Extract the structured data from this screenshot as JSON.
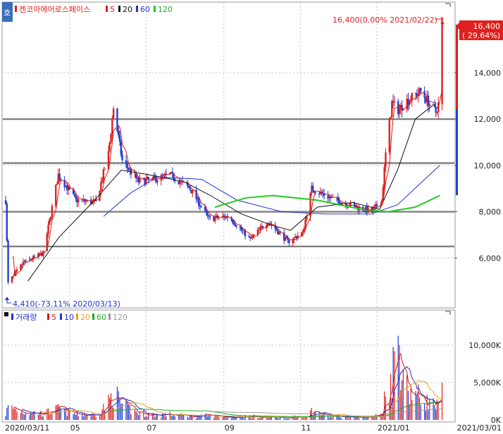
{
  "colors": {
    "up": "#e0201e",
    "down": "#1f3fd8",
    "ma5": "#d01a1a",
    "ma20": "#111111",
    "ma60": "#2233cc",
    "ma120": "#22cc22",
    "vol_ma5": "#d01a1a",
    "vol_ma10": "#2233cc",
    "vol_ma20": "#e8a020",
    "vol_ma60": "#22aa22",
    "vol_ma120": "#999999",
    "support_line": "#808080",
    "grid": "#c8c8c8",
    "price_tag_bg": "#e0201e"
  },
  "price_panel": {
    "badge": "호",
    "legend": {
      "name": "켄코아에어로스페이스",
      "ma5": "5",
      "ma20": "20",
      "ma60": "60",
      "ma120": "120"
    },
    "high_label": "16,400(0.00% 2021/02/22)",
    "low_label": "4,410(-73.11% 2020/03/13)",
    "last_price_tag": "16,400",
    "last_change_tag": "( 29.64%)",
    "y_ticks": [
      "14,000",
      "12,000",
      "10,000",
      "8,000",
      "6,000"
    ]
  },
  "volume_panel": {
    "legend": {
      "name": "거래량",
      "ma5": "5",
      "ma10": "10",
      "ma20": "20",
      "ma60": "60",
      "ma120": "120"
    },
    "y_ticks": [
      "10,000K",
      "5,000K",
      "0K"
    ]
  },
  "x_axis": {
    "labels": [
      "2020/03/11",
      "05",
      "07",
      "09",
      "11",
      "2021/01",
      "2021/03/01"
    ]
  },
  "chart_data": {
    "type": "candlestick",
    "title": "켄코아에어로스페이스",
    "price_ylim": [
      4000,
      16900
    ],
    "volume_ylim": [
      0,
      13000
    ],
    "price_ticks": [
      6000,
      8000,
      10000,
      12000,
      14000
    ],
    "horizontal_lines": [
      12000,
      10100,
      8000,
      6500
    ],
    "anchors": [
      {
        "date": "2020/03/11",
        "close": 8500,
        "volume": 800
      },
      {
        "date": "2020/03/13",
        "close": 4900,
        "volume": 1800,
        "low": 4410
      },
      {
        "date": "2020/03/25",
        "close": 5800,
        "volume": 1200
      },
      {
        "date": "2020/04/10",
        "close": 6200,
        "volume": 900
      },
      {
        "date": "2020/04/22",
        "close": 9600,
        "volume": 1500
      },
      {
        "date": "2020/05/06",
        "close": 8500,
        "volume": 800
      },
      {
        "date": "2020/05/22",
        "close": 8400,
        "volume": 700
      },
      {
        "date": "2020/06/01",
        "close": 10500,
        "volume": 2400
      },
      {
        "date": "2020/06/05",
        "close": 12500,
        "volume": 4000
      },
      {
        "date": "2020/06/12",
        "close": 10200,
        "volume": 2000
      },
      {
        "date": "2020/06/25",
        "close": 9300,
        "volume": 1000
      },
      {
        "date": "2020/07/08",
        "close": 9400,
        "volume": 700
      },
      {
        "date": "2020/07/20",
        "close": 9600,
        "volume": 800
      },
      {
        "date": "2020/08/05",
        "close": 9000,
        "volume": 500
      },
      {
        "date": "2020/08/20",
        "close": 7700,
        "volume": 600
      },
      {
        "date": "2020/09/05",
        "close": 7800,
        "volume": 400
      },
      {
        "date": "2020/09/22",
        "close": 6800,
        "volume": 500
      },
      {
        "date": "2020/10/06",
        "close": 7600,
        "volume": 400
      },
      {
        "date": "2020/10/22",
        "close": 6700,
        "volume": 400
      },
      {
        "date": "2020/11/03",
        "close": 7100,
        "volume": 400
      },
      {
        "date": "2020/11/10",
        "close": 9000,
        "volume": 1200
      },
      {
        "date": "2020/11/25",
        "close": 8600,
        "volume": 500
      },
      {
        "date": "2020/12/10",
        "close": 8300,
        "volume": 400
      },
      {
        "date": "2020/12/28",
        "close": 8000,
        "volume": 400
      },
      {
        "date": "2021/01/05",
        "close": 8500,
        "volume": 900
      },
      {
        "date": "2021/01/08",
        "close": 10500,
        "volume": 3800
      },
      {
        "date": "2021/01/13",
        "close": 12700,
        "volume": 6500
      },
      {
        "date": "2021/01/18",
        "close": 12400,
        "volume": 11500
      },
      {
        "date": "2021/01/25",
        "close": 12800,
        "volume": 4500
      },
      {
        "date": "2021/02/05",
        "close": 13200,
        "volume": 3000
      },
      {
        "date": "2021/02/17",
        "close": 12300,
        "volume": 2000
      },
      {
        "date": "2021/02/19",
        "close": 12650,
        "volume": 1800
      },
      {
        "date": "2021/02/22",
        "close": 16400,
        "volume": 5000,
        "high": 16400
      }
    ],
    "moving_averages": {
      "ma20": [
        [
          0.05,
          5000
        ],
        [
          0.12,
          6900
        ],
        [
          0.2,
          8500
        ],
        [
          0.26,
          9800
        ],
        [
          0.32,
          9600
        ],
        [
          0.4,
          9300
        ],
        [
          0.46,
          8700
        ],
        [
          0.53,
          7900
        ],
        [
          0.6,
          7400
        ],
        [
          0.64,
          7200
        ],
        [
          0.7,
          8200
        ],
        [
          0.78,
          8400
        ],
        [
          0.84,
          8100
        ],
        [
          0.88,
          9800
        ],
        [
          0.92,
          12000
        ],
        [
          0.96,
          12600
        ]
      ],
      "ma60": [
        [
          0.22,
          7800
        ],
        [
          0.28,
          8800
        ],
        [
          0.34,
          9500
        ],
        [
          0.44,
          9400
        ],
        [
          0.52,
          8500
        ],
        [
          0.62,
          8000
        ],
        [
          0.72,
          7900
        ],
        [
          0.82,
          7900
        ],
        [
          0.88,
          8300
        ],
        [
          0.93,
          9200
        ],
        [
          0.975,
          10000
        ]
      ],
      "ma120": [
        [
          0.47,
          8200
        ],
        [
          0.54,
          8600
        ],
        [
          0.6,
          8700
        ],
        [
          0.7,
          8500
        ],
        [
          0.8,
          8100
        ],
        [
          0.86,
          8000
        ],
        [
          0.92,
          8200
        ],
        [
          0.975,
          8700
        ]
      ]
    }
  }
}
